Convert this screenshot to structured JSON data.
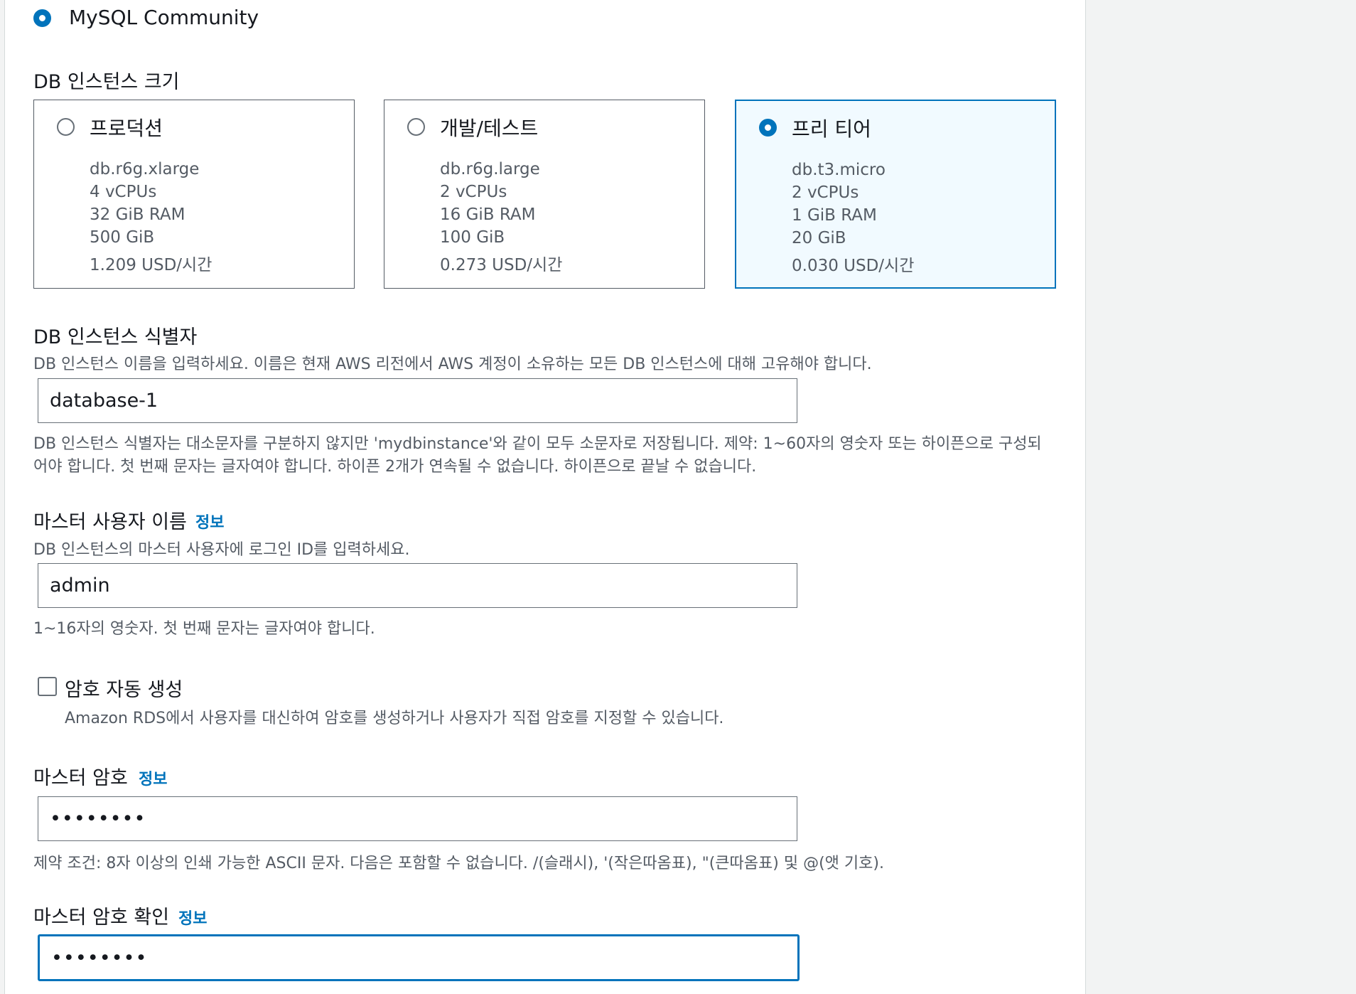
{
  "engine": {
    "option_label": "MySQL Community",
    "selected": true
  },
  "instance_size": {
    "label": "DB 인스턴스 크기",
    "options": [
      {
        "title": "프로덕션",
        "class": "db.r6g.xlarge",
        "vcpu": "4 vCPUs",
        "ram": "32 GiB RAM",
        "storage": "500 GiB",
        "price": "1.209 USD/시간",
        "selected": false
      },
      {
        "title": "개발/테스트",
        "class": "db.r6g.large",
        "vcpu": "2 vCPUs",
        "ram": "16 GiB RAM",
        "storage": "100 GiB",
        "price": "0.273 USD/시간",
        "selected": false
      },
      {
        "title": "프리 티어",
        "class": "db.t3.micro",
        "vcpu": "2 vCPUs",
        "ram": "1 GiB RAM",
        "storage": "20 GiB",
        "price": "0.030 USD/시간",
        "selected": true
      }
    ]
  },
  "identifier": {
    "label": "DB 인스턴스 식별자",
    "description": "DB 인스턴스 이름을 입력하세요. 이름은 현재 AWS 리전에서 AWS 계정이 소유하는 모든 DB 인스턴스에 대해 고유해야 합니다.",
    "value": "database-1",
    "constraint_line1": "DB 인스턴스 식별자는 대소문자를 구분하지 않지만 'mydbinstance'와 같이 모두 소문자로 저장됩니다. 제약: 1~60자의 영숫자 또는 하이픈으로 구성되",
    "constraint_line2": "어야 합니다. 첫 번째 문자는 글자여야 합니다. 하이픈 2개가 연속될 수 없습니다. 하이픈으로 끝날 수 없습니다."
  },
  "master_username": {
    "label": "마스터 사용자 이름",
    "info": "정보",
    "description": "DB 인스턴스의 마스터 사용자에 로그인 ID를 입력하세요.",
    "value": "admin",
    "constraint": "1~16자의 영숫자. 첫 번째 문자는 글자여야 합니다."
  },
  "auto_password": {
    "label": "암호 자동 생성",
    "description": "Amazon RDS에서 사용자를 대신하여 암호를 생성하거나 사용자가 직접 암호를 지정할 수 있습니다.",
    "checked": false
  },
  "master_password": {
    "label": "마스터 암호",
    "info": "정보",
    "value": "••••••••",
    "constraint": "제약 조건: 8자 이상의 인쇄 가능한 ASCII 문자. 다음은 포함할 수 없습니다. /(슬래시), '(작은따옴표), \"(큰따옴표) 및 @(앳 기호)."
  },
  "confirm_password": {
    "label": "마스터 암호 확인",
    "info": "정보",
    "value": "••••••••"
  },
  "colors": {
    "accent": "#0073bb",
    "selected_card_bg": "#f1faff",
    "secondary_text": "#545b64"
  }
}
